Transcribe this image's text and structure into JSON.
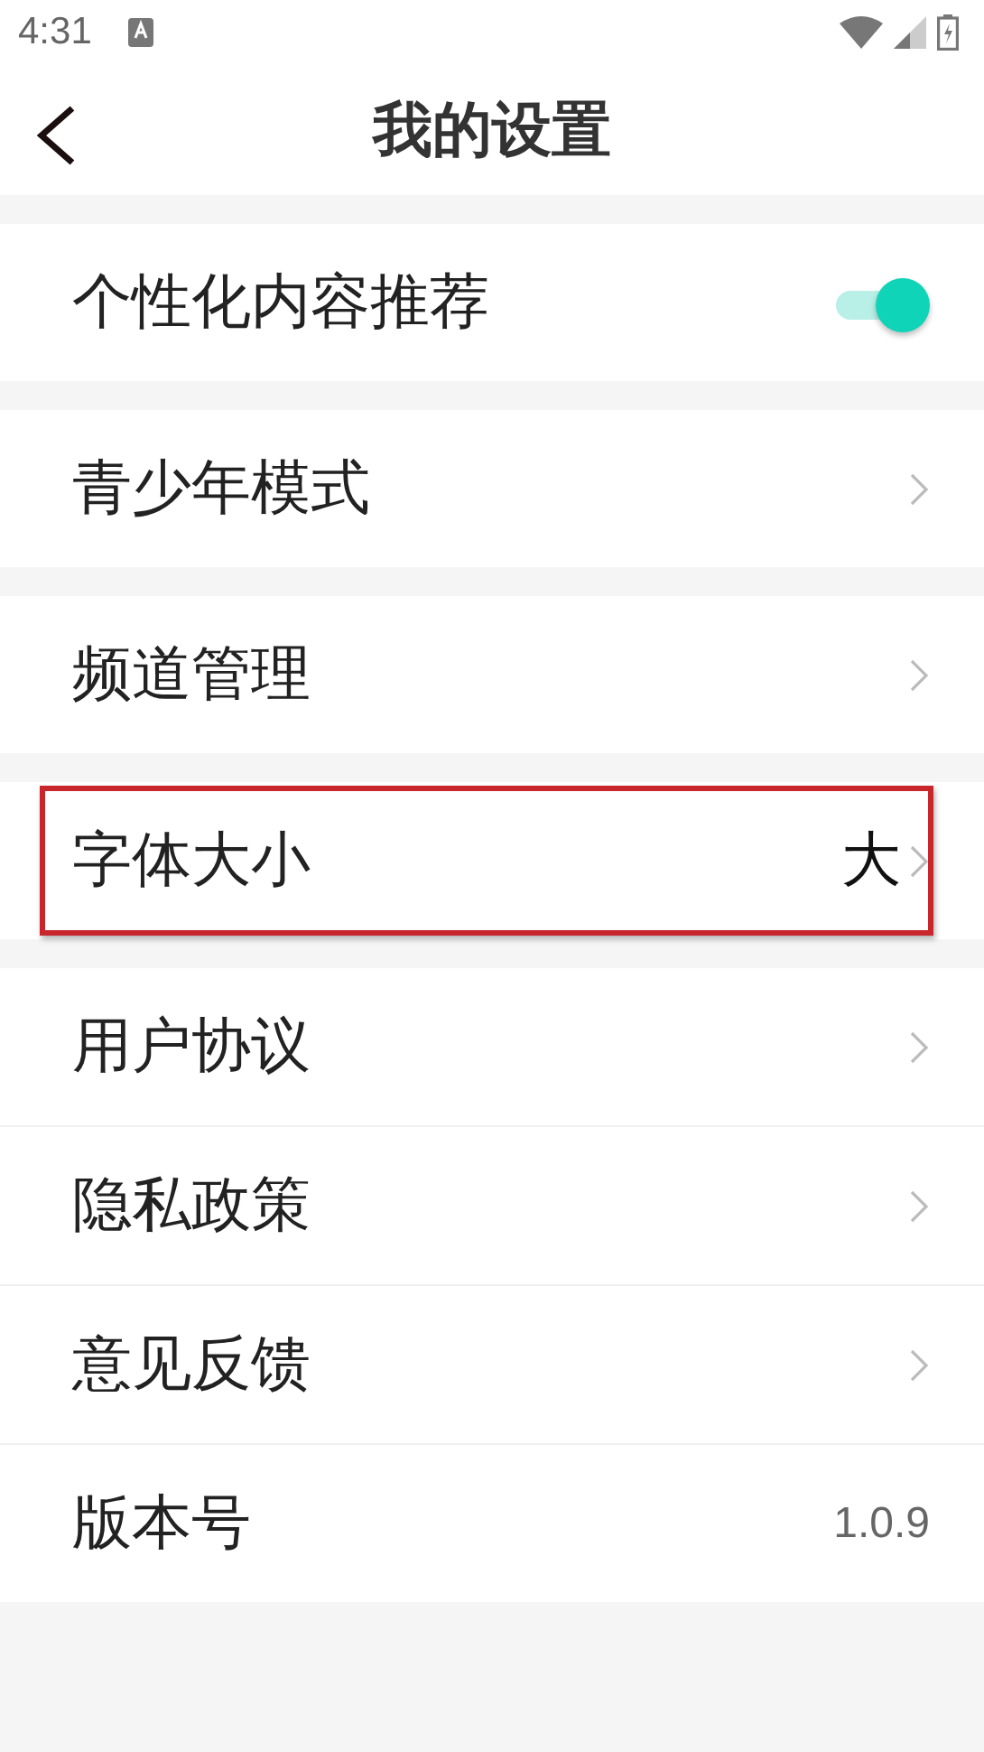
{
  "status_bar": {
    "time": "4:31"
  },
  "header": {
    "title": "我的设置"
  },
  "groups": [
    {
      "rows": [
        {
          "kind": "toggle",
          "label": "个性化内容推荐",
          "on": true
        }
      ]
    },
    {
      "rows": [
        {
          "kind": "link",
          "label": "青少年模式"
        }
      ]
    },
    {
      "rows": [
        {
          "kind": "link",
          "label": "频道管理"
        }
      ]
    },
    {
      "rows": [
        {
          "kind": "link",
          "label": "字体大小",
          "value": "大",
          "highlighted": true
        }
      ]
    },
    {
      "rows": [
        {
          "kind": "link",
          "label": "用户协议"
        },
        {
          "kind": "link",
          "label": "隐私政策"
        },
        {
          "kind": "link",
          "label": "意见反馈"
        },
        {
          "kind": "value",
          "label": "版本号",
          "value": "1.0.9"
        }
      ]
    }
  ]
}
